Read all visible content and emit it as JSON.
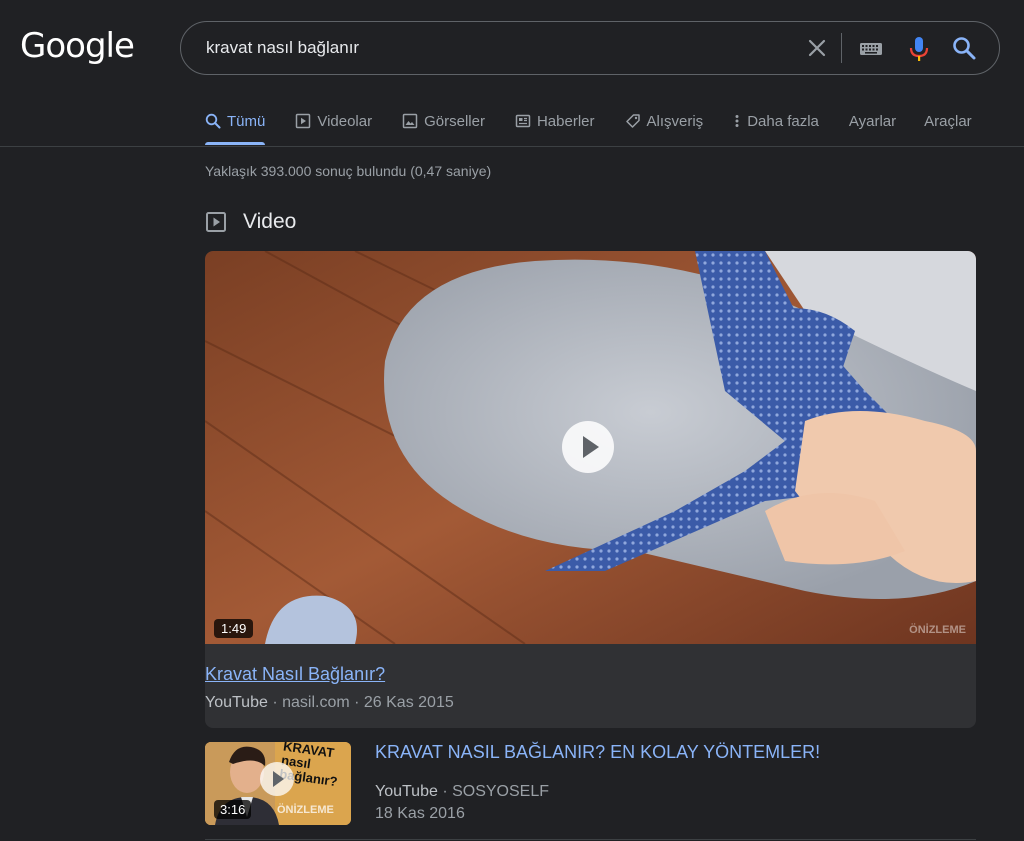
{
  "header": {
    "logo_text": "Google",
    "search": {
      "query": "kravat nasıl bağlanır"
    }
  },
  "tabs": {
    "items": [
      {
        "label": "Tümü",
        "icon": "search-icon",
        "active": true
      },
      {
        "label": "Videolar",
        "icon": "video-icon"
      },
      {
        "label": "Görseller",
        "icon": "image-icon"
      },
      {
        "label": "Haberler",
        "icon": "news-icon"
      },
      {
        "label": "Alışveriş",
        "icon": "tag-icon"
      },
      {
        "label": "Daha fazla",
        "icon": "more-vertical-icon"
      }
    ],
    "settings": "Ayarlar",
    "tools": "Araçlar"
  },
  "results": {
    "stats": "Yaklaşık 393.000 sonuç bulundu (0,47 saniye)",
    "video_section_title": "Video",
    "featured_video": {
      "duration": "1:49",
      "preview_badge": "ÖNİZLEME",
      "title": "Kravat Nasıl Bağlanır?",
      "source": "YouTube",
      "meta": " · nasil.com · 26 Kas 2015"
    },
    "video2": {
      "duration": "3:16",
      "preview_badge": "ÖNİZLEME",
      "thumb_text": [
        "KRAVAT",
        "nasıl",
        "bağlanır?"
      ],
      "title": "KRAVAT NASIL BAĞLANIR? EN KOLAY YÖNTEMLER!",
      "source": "YouTube",
      "meta": " · SOSYOSELF",
      "date": "18 Kas 2016"
    }
  },
  "colors": {
    "background": "#202124",
    "link": "#8ab4f8",
    "text": "#bdc1c6",
    "muted": "#9aa0a6"
  }
}
